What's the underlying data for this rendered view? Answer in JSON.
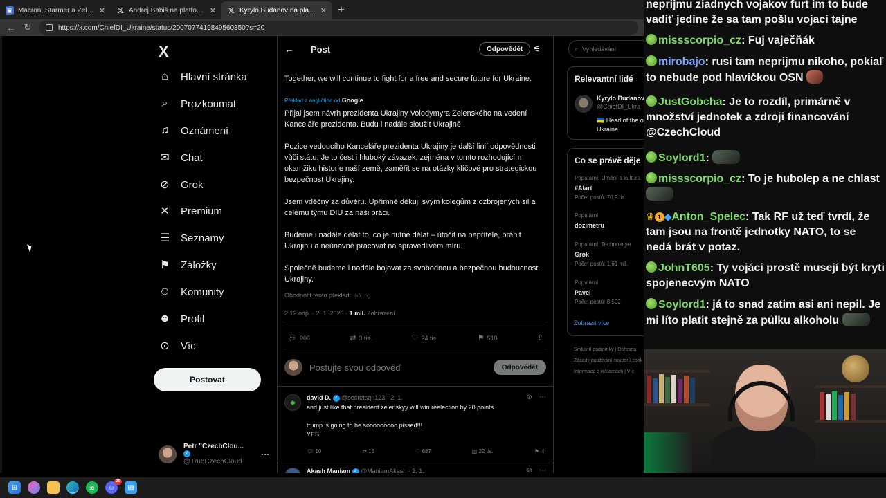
{
  "browser": {
    "tabs": [
      {
        "title": "Macron, Starmer a Zelenskyj pode",
        "icon": "news-favicon-icon",
        "active": false
      },
      {
        "title": "Andrej Babiš na platformě X: „Dne",
        "icon": "x-favicon-icon",
        "active": false
      },
      {
        "title": "Kyrylo Budanov na platformě X: „J",
        "icon": "x-favicon-icon",
        "active": true
      }
    ],
    "url": "https://x.com/ChiefDI_Ukraine/status/2007077419849560350?s=20"
  },
  "x_nav": {
    "logo": "X",
    "items": [
      {
        "label": "Hlavní stránka",
        "icon": "home-icon",
        "glyph": "⌂"
      },
      {
        "label": "Prozkoumat",
        "icon": "search-icon",
        "glyph": "⌕"
      },
      {
        "label": "Oznámení",
        "icon": "bell-icon",
        "glyph": "🔔"
      },
      {
        "label": "Chat",
        "icon": "mail-icon",
        "glyph": "✉"
      },
      {
        "label": "Grok",
        "icon": "grok-icon",
        "glyph": "⊘"
      },
      {
        "label": "Premium",
        "icon": "x-premium-icon",
        "glyph": "✕"
      },
      {
        "label": "Seznamy",
        "icon": "list-icon",
        "glyph": "☰"
      },
      {
        "label": "Záložky",
        "icon": "bookmark-icon",
        "glyph": "🔖"
      },
      {
        "label": "Komunity",
        "icon": "communities-icon",
        "glyph": "👥"
      },
      {
        "label": "Profil",
        "icon": "profile-icon",
        "glyph": "👤"
      },
      {
        "label": "Víc",
        "icon": "more-circle-icon",
        "glyph": "⋯"
      }
    ],
    "post_button": "Postovat",
    "account": {
      "name": "Petr \"CzechClou...",
      "handle": "@TrueCzechCloud"
    }
  },
  "post": {
    "header_title": "Post",
    "reply_pill": "Odpovědět",
    "original_text": "Together, we will continue to fight for a free and secure future for Ukraine.",
    "translated_label": "Překlad z angličtina od",
    "translated_by": "Google",
    "paragraphs": [
      "Přijal jsem návrh prezidenta Ukrajiny Volodymyra Zelenského na vedení Kanceláře prezidenta. Budu i nadále sloužit Ukrajině.",
      "Pozice vedoucího Kanceláře prezidenta Ukrajiny je další linií odpovědnosti vůči státu. Je to čest i hluboký závazek, zejména v tomto rozhodujícím okamžiku historie naší země, zaměřit se na otázky klíčové pro strategickou bezpečnost Ukrajiny.",
      "Jsem vděčný za důvěru. Upřímně děkuji svým kolegům z ozbrojených sil a celému týmu DIU za naši práci.",
      "Budeme i nadále dělat to, co je nutné dělat – útočit na nepřítele, bránit Ukrajinu a neúnavně pracovat na spravedlivém míru.",
      "Společně budeme i nadále bojovat za svobodnou a bezpečnou budoucnost Ukrajiny."
    ],
    "rate_translation": "Ohodnotit tento překlad:",
    "time": "2:12 odp. · 2. 1. 2026 ·",
    "views": "1 mil.",
    "views_label": "Zobrazení",
    "stats": {
      "replies": "906",
      "reposts": "3 tis.",
      "likes": "24 tis.",
      "bookmarks": "510"
    },
    "reply_placeholder": "Postujte svou odpověď",
    "reply_submit": "Odpovědět"
  },
  "replies": [
    {
      "name": "david D.",
      "handle": "@secretsqrl123 · 2. 1.",
      "text_lines": [
        "and just like that president zelenskyy will win reelection by 20 points..",
        "",
        "trump is going to be sooooooooo pissed!!!",
        "YES"
      ],
      "stats": {
        "replies": "10",
        "reposts": "16",
        "likes": "687",
        "views": "22 tis."
      }
    },
    {
      "name": "Akash Maniam",
      "handle": "@ManiamAkash · 2. 1.",
      "text_lines": [],
      "stats": {}
    }
  ],
  "right_sidebar": {
    "search_placeholder": "Vyhledávání",
    "who_title": "Relevantní lidé",
    "who": {
      "name": "Kyrylo Budanov",
      "handle": "@ChiefDI_Ukra",
      "bio": "🇺🇦 Head of the of Ukraine"
    },
    "trends_title": "Co se právě děje",
    "trends": [
      {
        "context": "Populární: Umění a kultura",
        "name": "#Alart",
        "count": "Počet postů: 70,9 tis."
      },
      {
        "context": "Populární",
        "name": "dozimetru",
        "count": ""
      },
      {
        "context": "Populární: Technologie",
        "name": "Grok",
        "count": "Počet postů: 1,61 mil."
      },
      {
        "context": "Populární",
        "name": "Pavel",
        "count": "Počet postů: 8 502"
      }
    ],
    "show_more": "Zobrazit více",
    "footer_links": [
      "Smluvní podmínky  |  Ochrana",
      "Zásady používání souborů cook",
      "Informace o reklamách  |  Víc"
    ]
  },
  "chat": {
    "messages": [
      {
        "user": "",
        "text": "neprijmu ziadnych vojakov furt im to bude vadiť jedine že sa tam pošlu vojaci tajne",
        "badges": []
      },
      {
        "user": "missscorpio_cz",
        "text": "Fuj vaječňák",
        "badges": [
          "sub"
        ]
      },
      {
        "user": "mirobajo",
        "text": "rusi tam neprijmu nikoho, pokiaľ to nebude pod hlavičkou OSN",
        "badges": [
          "sub"
        ]
      },
      {
        "user": "JustGobcha",
        "text": "Je to rozdíl, primárně v množství jednotek a zdroji financování @CzechCloud",
        "badges": [
          "sub"
        ]
      },
      {
        "user": "Soylord1",
        "text": "",
        "badges": [
          "sub"
        ]
      },
      {
        "user": "missscorpio_cz",
        "text": "To je hubolep a ne chlast",
        "badges": [
          "sub"
        ]
      },
      {
        "user": "Anton_Spelec",
        "text": "Tak RF už teď tvrdí, že tam jsou na frontě jednotky NATO, to se nedá brát v potaz.",
        "badges": [
          "crown",
          "coin",
          "gem"
        ]
      },
      {
        "user": "JohnT605",
        "text": "Ty vojáci prostě musejí být kryti spojenecvým NATO",
        "badges": [
          "sub"
        ]
      },
      {
        "user": "Soylord1",
        "text": "já to snad zatim asi ani nepil. Je mi líto platit stejně za půlku alkoholu",
        "badges": [
          "sub"
        ]
      }
    ]
  },
  "taskbar": {
    "apps": [
      "windows-start-icon",
      "copilot-icon",
      "file-explorer-icon",
      "edge-icon",
      "spotify-icon",
      "discord-icon",
      "notepad-icon"
    ],
    "discord_badge": "29"
  }
}
